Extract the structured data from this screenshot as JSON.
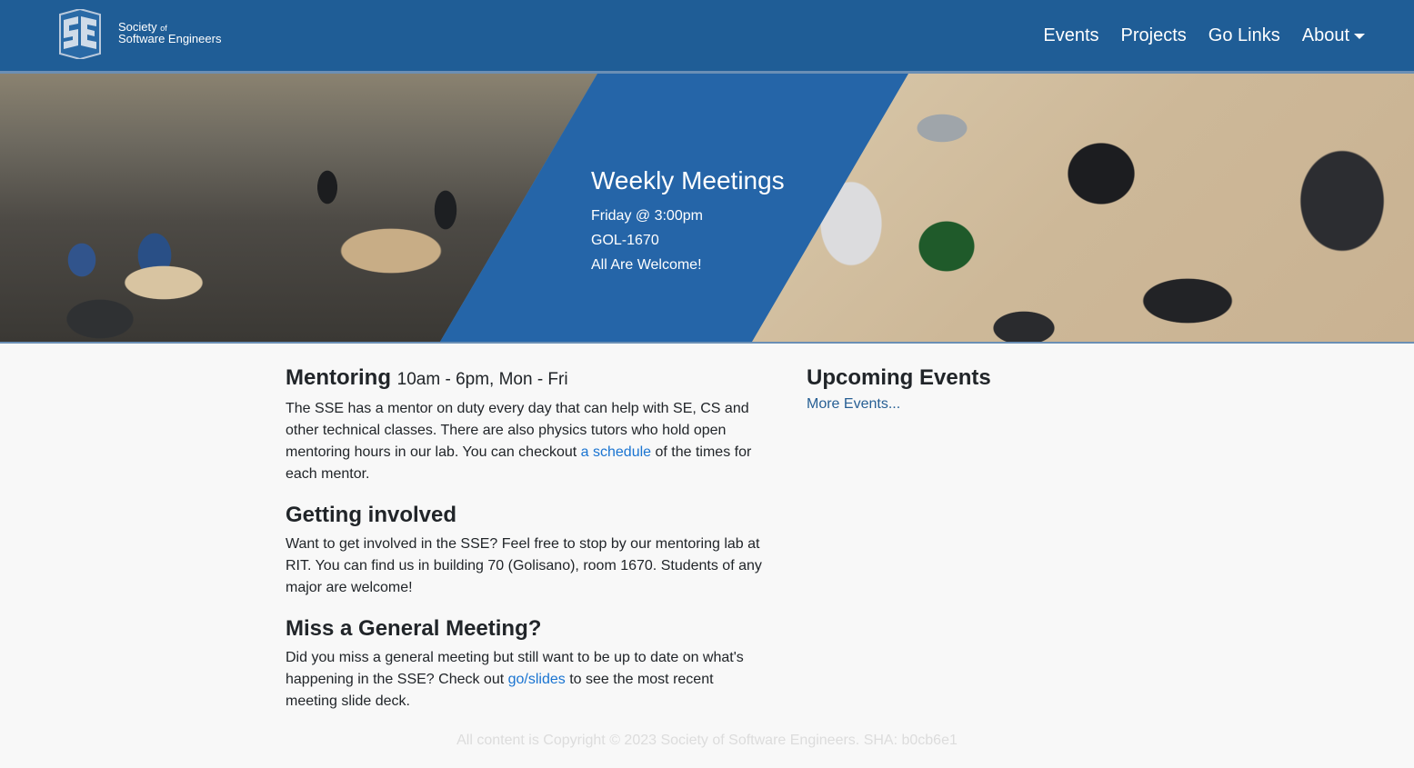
{
  "colors": {
    "navbar_bg": "#1f5d96",
    "hero_blue": "#2565a8",
    "link": "#1a74d1",
    "page_bg": "#f8f8f8"
  },
  "brand": {
    "logo_icon": "sse-logo-icon",
    "line1": "Society",
    "line1_small": "of",
    "line2": "Software Engineers"
  },
  "nav": {
    "events": "Events",
    "projects": "Projects",
    "golinks": "Go Links",
    "about": "About"
  },
  "hero": {
    "title": "Weekly Meetings",
    "line1": "Friday @ 3:00pm",
    "line2": "GOL-1670",
    "line3": "All Are Welcome!"
  },
  "mentoring": {
    "title": "Mentoring",
    "hours": "10am - 6pm, Mon - Fri",
    "text_before": "The SSE has a mentor on duty every day that can help with SE, CS and other technical classes. There are also physics tutors who hold open mentoring hours in our lab. You can checkout ",
    "link": "a schedule",
    "text_after": " of the times for each mentor."
  },
  "involved": {
    "title": "Getting involved",
    "text": "Want to get involved in the SSE? Feel free to stop by our mentoring lab at RIT. You can find us in building 70 (Golisano), room 1670. Students of any major are welcome!"
  },
  "general_meeting": {
    "title": "Miss a General Meeting?",
    "text_before": "Did you miss a general meeting but still want to be up to date on what's happening in the SSE? Check out ",
    "link": "go/slides",
    "text_after": " to see the most recent meeting slide deck."
  },
  "events": {
    "title": "Upcoming Events",
    "more": "More Events..."
  },
  "footer": {
    "text": "All content is Copyright © 2023 Society of Software Engineers. SHA: b0cb6e1"
  }
}
